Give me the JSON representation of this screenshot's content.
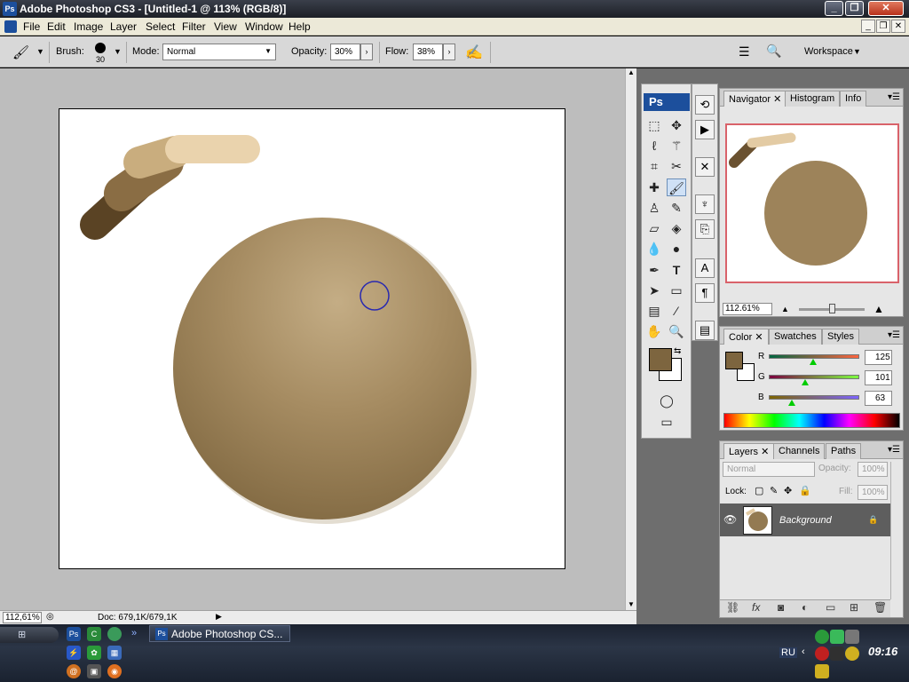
{
  "window": {
    "title": "Adobe Photoshop CS3 - [Untitled-1 @ 113% (RGB/8)]",
    "app_icon": "Ps"
  },
  "menu": [
    "File",
    "Edit",
    "Image",
    "Layer",
    "Select",
    "Filter",
    "View",
    "Window",
    "Help"
  ],
  "options": {
    "brush_label": "Brush:",
    "brush_size": "30",
    "mode_label": "Mode:",
    "mode_value": "Normal",
    "opacity_label": "Opacity:",
    "opacity_value": "30%",
    "flow_label": "Flow:",
    "flow_value": "38%",
    "workspace_label": "Workspace"
  },
  "status": {
    "zoom": "112,61%",
    "doc": "Doc: 679,1K/679,1K"
  },
  "toolbox": {
    "logo": "Ps"
  },
  "navigator": {
    "tabs": [
      "Navigator",
      "Histogram",
      "Info"
    ],
    "zoom": "112.61%"
  },
  "color_panel": {
    "tabs": [
      "Color",
      "Swatches",
      "Styles"
    ],
    "r_label": "R",
    "g_label": "G",
    "b_label": "B",
    "r": "125",
    "g": "101",
    "b": "63",
    "fg_color": "#7d653f",
    "bg_color": "#ffffff"
  },
  "layers_panel": {
    "tabs": [
      "Layers",
      "Channels",
      "Paths"
    ],
    "blend_mode": "Normal",
    "opacity_label": "Opacity:",
    "opacity": "100%",
    "lock_label": "Lock:",
    "fill_label": "Fill:",
    "fill": "100%",
    "layer_name": "Background"
  },
  "taskbar": {
    "task_label": "Adobe Photoshop CS...",
    "lang": "RU",
    "clock": "09:16"
  },
  "colors": {
    "accent": "#1c4f9c",
    "paint_brown": "#7d653f",
    "paint_light": "#e8cfa4"
  }
}
